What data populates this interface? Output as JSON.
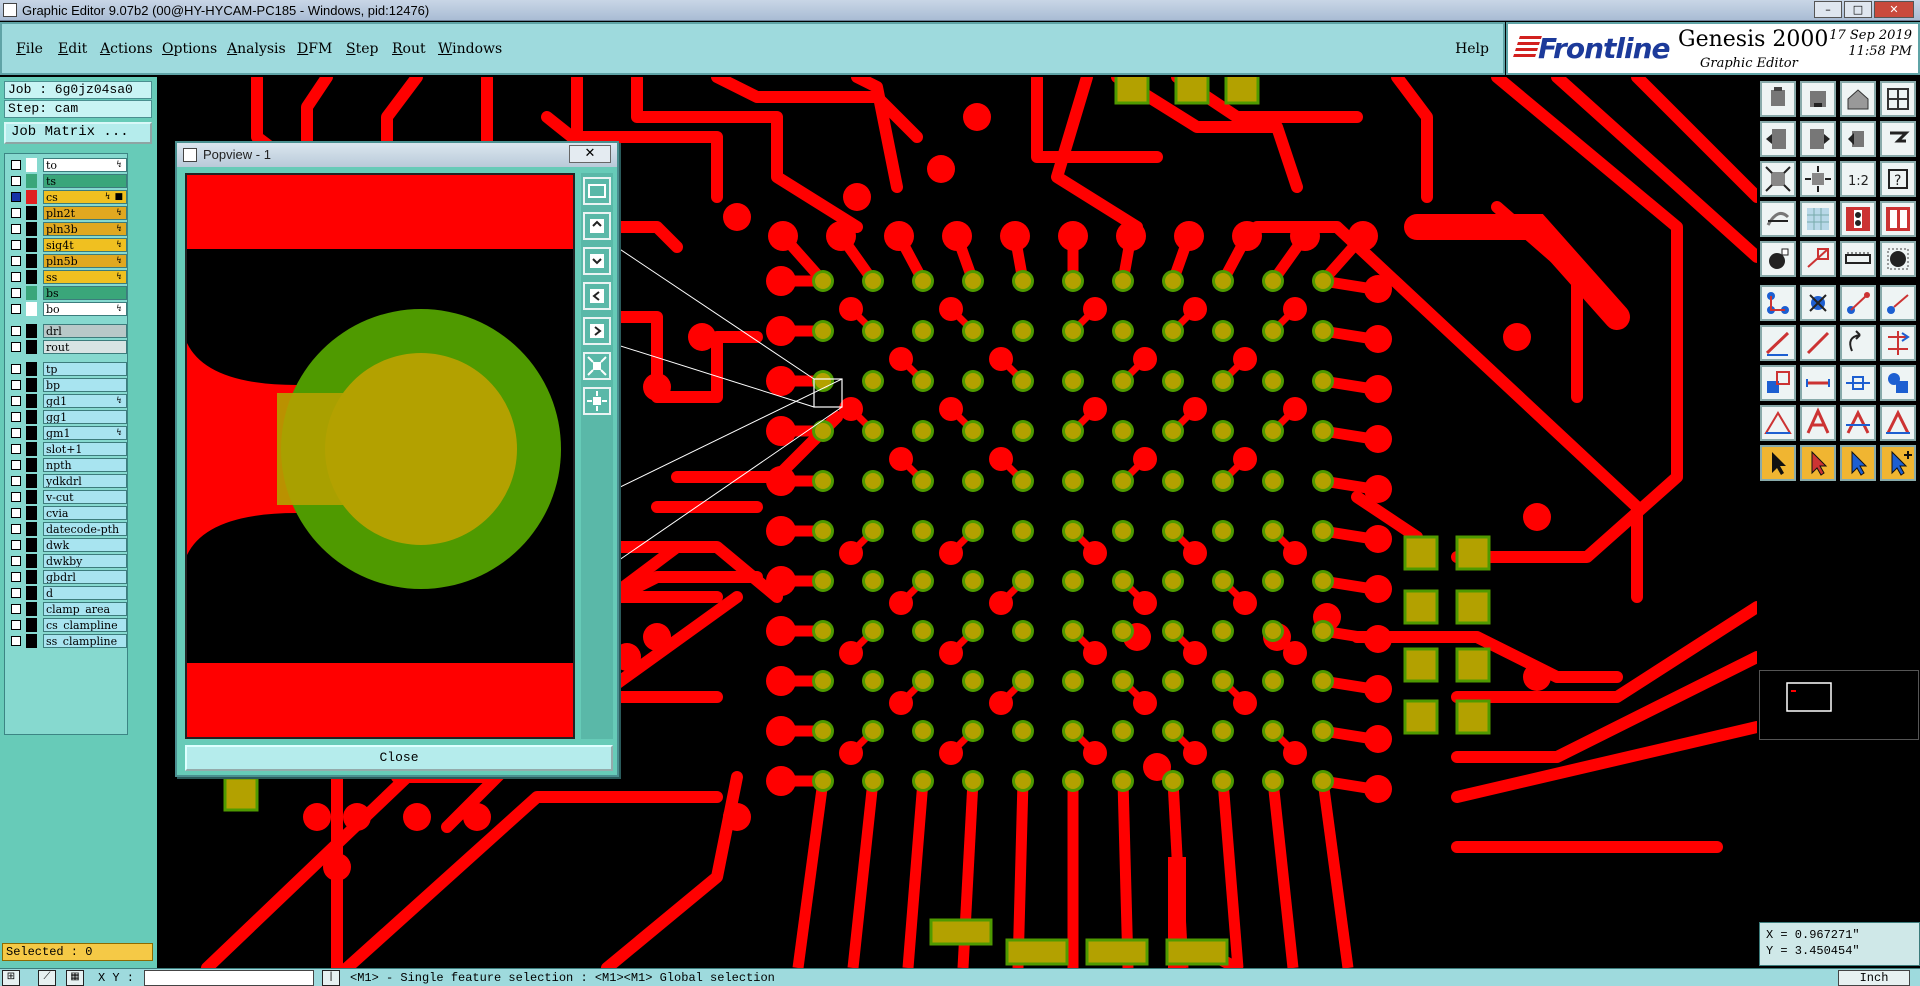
{
  "window": {
    "title": "Graphic Editor 9.07b2 (00@HY-HYCAM-PC185 - Windows, pid:12476)",
    "min": "–",
    "max": "□",
    "close": "✕"
  },
  "menu": {
    "items": [
      "File",
      "Edit",
      "Actions",
      "Options",
      "Analysis",
      "DFM",
      "Step",
      "Rout",
      "Windows"
    ],
    "help": "Help"
  },
  "brand": {
    "logo": "Frontline",
    "product": "Genesis 2000",
    "subtitle": "Graphic Editor",
    "date": "17 Sep 2019",
    "time": "11:58 PM"
  },
  "job": {
    "job_label": "Job : 6g0jz04sa0",
    "step_label": "Step: cam",
    "matrix_button": "Job Matrix ..."
  },
  "layers": [
    {
      "name": "to",
      "color": "#ffffff",
      "mark": "↯",
      "flag": "",
      "row_bg": "#ffffff"
    },
    {
      "name": "ts",
      "color": "#3aa67a",
      "mark": "",
      "flag": "",
      "row_bg": "#3aa67a"
    },
    {
      "name": "cs",
      "color": "#e02020",
      "mark": "↯ ■",
      "flag": "#1533a8",
      "row_bg": "#f0c020"
    },
    {
      "name": "pln2t",
      "color": "#000000",
      "mark": "↯",
      "flag": "",
      "row_bg": "#e0a820"
    },
    {
      "name": "pln3b",
      "color": "#000000",
      "mark": "↯",
      "flag": "",
      "row_bg": "#e0a820"
    },
    {
      "name": "sig4t",
      "color": "#000000",
      "mark": "↯",
      "flag": "",
      "row_bg": "#f0c020"
    },
    {
      "name": "pln5b",
      "color": "#000000",
      "mark": "↯",
      "flag": "",
      "row_bg": "#e0a820"
    },
    {
      "name": "ss",
      "color": "#000000",
      "mark": "↯",
      "flag": "",
      "row_bg": "#f0c020"
    },
    {
      "name": "bs",
      "color": "#3aa67a",
      "mark": "",
      "flag": "",
      "row_bg": "#3aa67a"
    },
    {
      "name": "bo",
      "color": "#ffffff",
      "mark": "↯",
      "flag": "",
      "row_bg": "#ffffff"
    },
    {
      "name": "drl",
      "color": "#000000",
      "mark": "",
      "flag": "",
      "row_bg": "#b8c8c8"
    },
    {
      "name": "rout",
      "color": "#000000",
      "mark": "",
      "flag": "",
      "row_bg": "#d8e4e4"
    },
    {
      "name": "tp",
      "color": "#000000",
      "mark": "",
      "flag": "",
      "row_bg": "#a8e4f0"
    },
    {
      "name": "bp",
      "color": "#000000",
      "mark": "",
      "flag": "",
      "row_bg": "#a8e4f0"
    },
    {
      "name": "gd1",
      "color": "#000000",
      "mark": "↯",
      "flag": "",
      "row_bg": "#a8e4f0"
    },
    {
      "name": "gg1",
      "color": "#000000",
      "mark": "",
      "flag": "",
      "row_bg": "#a8e4f0"
    },
    {
      "name": "gm1",
      "color": "#000000",
      "mark": "↯",
      "flag": "",
      "row_bg": "#a8e4f0"
    },
    {
      "name": "slot+1",
      "color": "#000000",
      "mark": "",
      "flag": "",
      "row_bg": "#a8e4f0"
    },
    {
      "name": "npth",
      "color": "#000000",
      "mark": "",
      "flag": "",
      "row_bg": "#a8e4f0"
    },
    {
      "name": "ydkdrl",
      "color": "#000000",
      "mark": "",
      "flag": "",
      "row_bg": "#a8e4f0"
    },
    {
      "name": "v-cut",
      "color": "#000000",
      "mark": "",
      "flag": "",
      "row_bg": "#a8e4f0"
    },
    {
      "name": "cvia",
      "color": "#000000",
      "mark": "",
      "flag": "",
      "row_bg": "#a8e4f0"
    },
    {
      "name": "datecode-pth",
      "color": "#000000",
      "mark": "",
      "flag": "",
      "row_bg": "#a8e4f0"
    },
    {
      "name": "dwk",
      "color": "#000000",
      "mark": "",
      "flag": "",
      "row_bg": "#a8e4f0"
    },
    {
      "name": "dwkby",
      "color": "#000000",
      "mark": "",
      "flag": "",
      "row_bg": "#a8e4f0"
    },
    {
      "name": "gbdrl",
      "color": "#000000",
      "mark": "",
      "flag": "",
      "row_bg": "#a8e4f0"
    },
    {
      "name": "d",
      "color": "#000000",
      "mark": "",
      "flag": "",
      "row_bg": "#a8e4f0"
    },
    {
      "name": "clamp_area",
      "color": "#000000",
      "mark": "",
      "flag": "",
      "row_bg": "#a8e4f0"
    },
    {
      "name": "cs_clampline",
      "color": "#000000",
      "mark": "",
      "flag": "",
      "row_bg": "#a8e4f0"
    },
    {
      "name": "ss_clampline",
      "color": "#000000",
      "mark": "",
      "flag": "",
      "row_bg": "#a8e4f0"
    }
  ],
  "status": {
    "selected": "Selected : 0",
    "x": "X = 0.967271\"",
    "y": "Y = 3.450454\"",
    "xy_label": "X Y :",
    "hint": "<M1> - Single feature selection : <M1><M1> Global selection",
    "unit": "Inch"
  },
  "popview": {
    "title": "Popview - 1",
    "close_x": "✕",
    "close_button": "Close"
  },
  "colors": {
    "trace": "#ff0000",
    "pad": "#b3a100",
    "pad_ring": "#4f9a00",
    "panel": "#67cbb8",
    "menu": "#9edadd"
  }
}
